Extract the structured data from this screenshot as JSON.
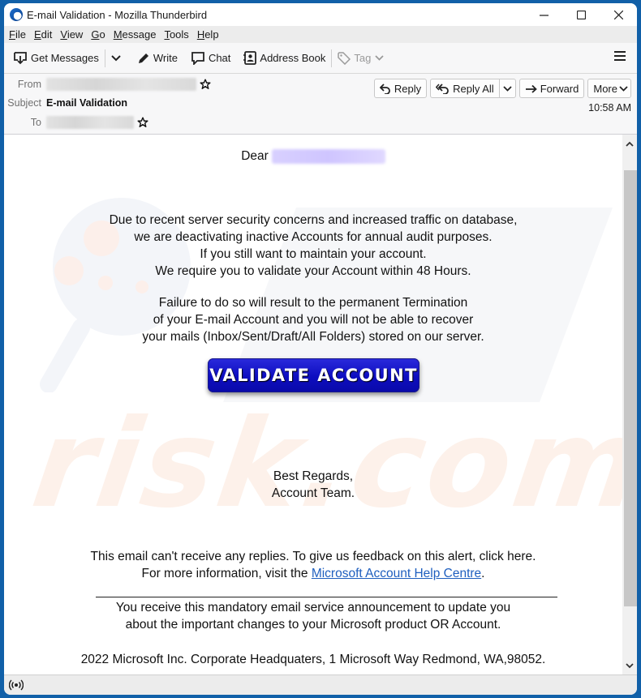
{
  "window": {
    "title": "E-mail Validation - Mozilla Thunderbird",
    "controls": {
      "minimize": "minimize-icon",
      "maximize": "maximize-icon",
      "close": "close-icon"
    }
  },
  "menubar": {
    "items": [
      {
        "label": "File",
        "accel": "F",
        "rest": "ile"
      },
      {
        "label": "Edit",
        "accel": "E",
        "rest": "dit"
      },
      {
        "label": "View",
        "accel": "V",
        "rest": "iew"
      },
      {
        "label": "Go",
        "accel": "G",
        "rest": "o"
      },
      {
        "label": "Message",
        "accel": "M",
        "rest": "essage"
      },
      {
        "label": "Tools",
        "accel": "T",
        "rest": "ools"
      },
      {
        "label": "Help",
        "accel": "H",
        "rest": "elp"
      }
    ]
  },
  "toolbar": {
    "get_messages": "Get Messages",
    "write": "Write",
    "chat": "Chat",
    "address_book": "Address Book",
    "tag": "Tag"
  },
  "header": {
    "from_label": "From",
    "subject_label": "Subject",
    "subject": "E-mail Validation",
    "to_label": "To",
    "time": "10:58 AM",
    "buttons": {
      "reply": "Reply",
      "reply_all": "Reply All",
      "forward": "Forward",
      "more": "More"
    }
  },
  "email": {
    "greeting": "Dear",
    "paragraph1": [
      "Due to recent server security concerns and increased traffic on database,",
      "we are deactivating inactive Accounts for annual audit purposes.",
      "If you still want to maintain your account.",
      "We require you to validate your Account within 48 Hours."
    ],
    "paragraph2": [
      "Failure to do so will result to the permanent Termination",
      "of your E-mail Account and you will not be able to recover",
      "your mails (Inbox/Sent/Draft/All Folders) stored on our server."
    ],
    "cta_label": "VALIDATE ACCOUNT",
    "signoff": [
      "Best Regards,",
      "Account Team."
    ],
    "footer_line1": "This email can't receive any replies. To give us feedback on this alert, click here.",
    "footer_line2_prefix": "For more information, visit the ",
    "footer_link": "Microsoft Account Help Centre",
    "footer_line2_suffix": ".",
    "notice": [
      "You receive this mandatory email service announcement to update you",
      "about the important changes to your Microsoft product OR Account."
    ],
    "address": "2022 Microsoft Inc. Corporate Headquaters, 1 Microsoft Way Redmond, WA,98052.",
    "watermark": "risk.com"
  },
  "colors": {
    "frame": "#1160a8",
    "cta_bg": "#0d0dc0",
    "link": "#1f5fbf"
  }
}
